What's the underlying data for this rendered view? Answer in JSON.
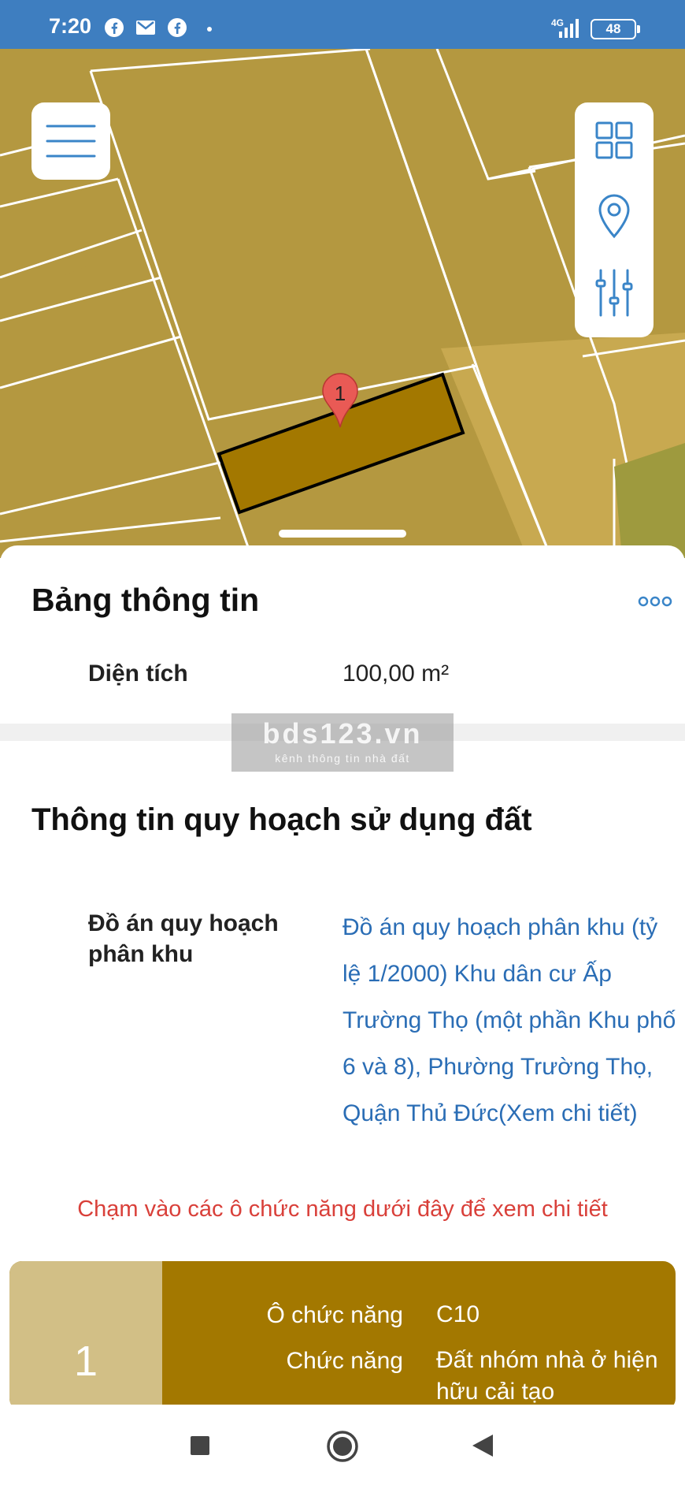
{
  "status_bar": {
    "time": "7:20",
    "network_label": "4G",
    "battery_level": "48",
    "notification_icons": [
      "facebook-icon",
      "gmail-icon",
      "facebook-icon",
      "dot-icon"
    ]
  },
  "map": {
    "marker_label": "1",
    "colors": {
      "land": "#b49840",
      "parcel_selected": "#a37800",
      "road": "#c8a950",
      "lines": "#ffffff",
      "marker": "#e95a55"
    }
  },
  "info_sheet": {
    "title": "Bảng thông tin",
    "area_label": "Diện tích",
    "area_value": "100,00 m²"
  },
  "watermark": {
    "title": "bds123.vn",
    "subtitle": "kênh thông tin nhà đất"
  },
  "planning": {
    "section_title": "Thông tin quy hoạch sử dụng đất",
    "plan_label": "Đồ án quy hoạch phân khu",
    "plan_value": "Đồ án quy hoạch phân khu (tỷ lệ 1/2000) Khu dân cư Ấp Trường Thọ (một phần Khu phố 6 và 8), Phường Trường Thọ, Quận Thủ Đức(Xem chi tiết)",
    "hint": "Chạm vào các ô chức năng dưới đây để xem chi tiết"
  },
  "function_cell": {
    "number": "1",
    "code_label": "Ô chức năng",
    "code_value": "C10",
    "function_label": "Chức năng",
    "function_value": "Đất nhóm nhà ở hiện hữu cải tạo",
    "colors": {
      "number_bg": "#d2bf86",
      "card_bg": "#a37800"
    }
  },
  "accent_color": "#2a6db5"
}
